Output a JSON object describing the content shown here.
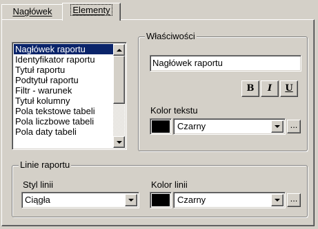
{
  "tabs": [
    {
      "label": "Nagłówek",
      "active": false
    },
    {
      "label": "Elementy",
      "active": true
    }
  ],
  "elements_list": {
    "items": [
      "Nagłówek raportu",
      "Identyfikator raportu",
      "Tytuł raportu",
      "Podtytuł raportu",
      "Filtr - warunek",
      "Tytuł kolumny",
      "Pola tekstowe tabeli",
      "Pola liczbowe tabeli",
      "Pola daty tabeli"
    ],
    "selected_index": 0
  },
  "properties": {
    "legend": "Właściwości",
    "text_value": "Nagłówek raportu",
    "bold_label": "B",
    "italic_label": "I",
    "underline_label": "U",
    "text_color_label": "Kolor tekstu",
    "text_color_value": "Czarny",
    "text_color_hex": "#000000",
    "more_label": "..."
  },
  "report_lines": {
    "legend": "Linie raportu",
    "style_label": "Styl linii",
    "style_value": "Ciągła",
    "color_label": "Kolor linii",
    "color_value": "Czarny",
    "color_hex": "#000000",
    "more_label": "..."
  }
}
